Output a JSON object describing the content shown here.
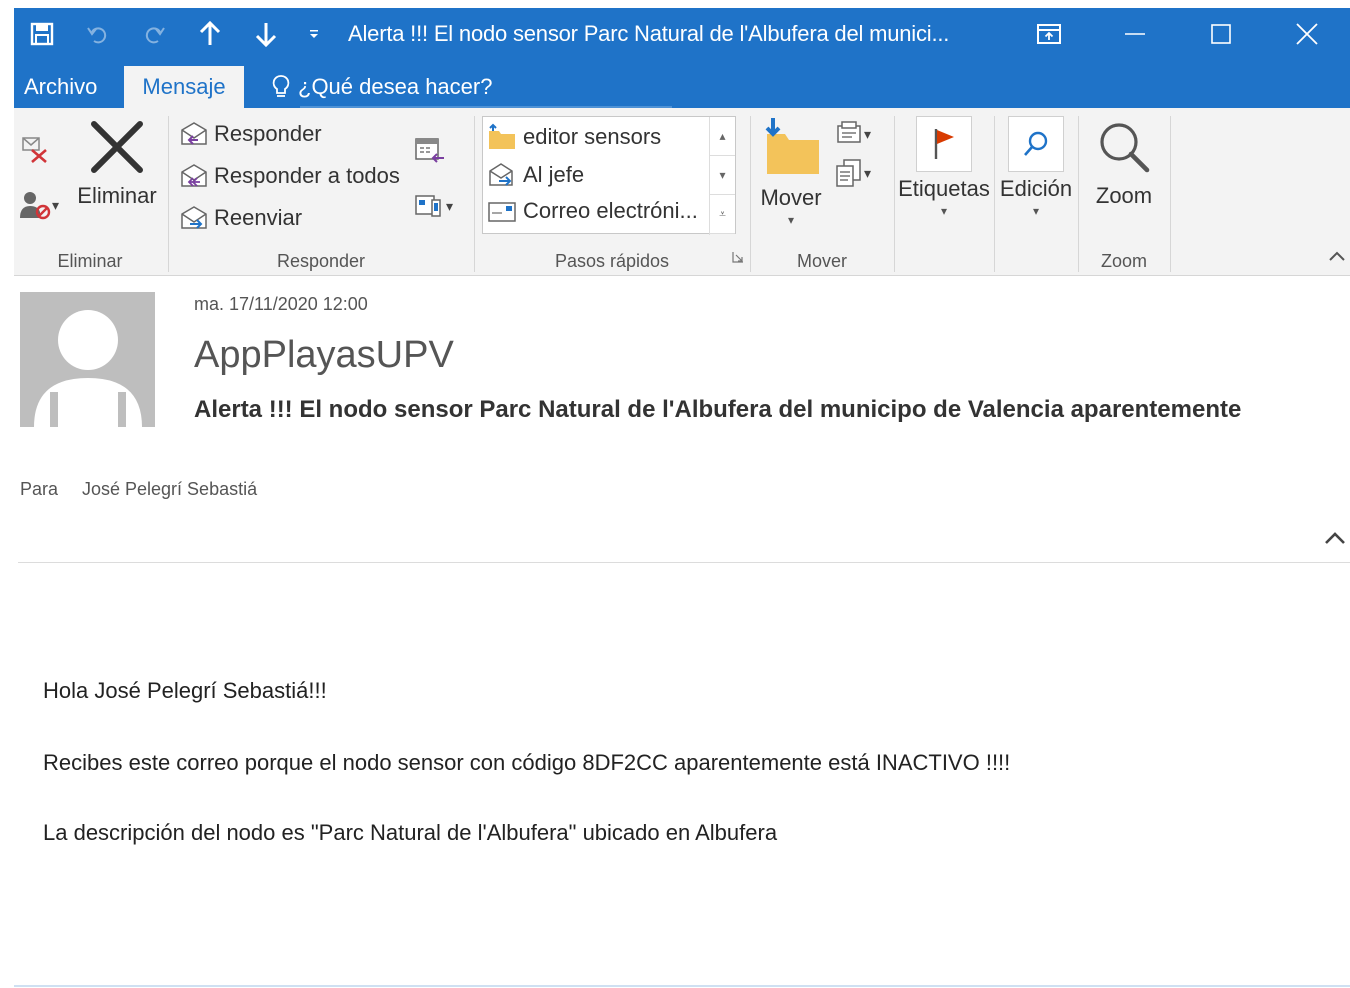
{
  "window": {
    "title": "Alerta !!! El nodo sensor Parc Natural de l'Albufera del munici..."
  },
  "tabs": {
    "archivo": "Archivo",
    "mensaje": "Mensaje",
    "tell_me": "¿Qué desea hacer?"
  },
  "ribbon": {
    "eliminar_group": {
      "label": "Eliminar",
      "delete_button": "Eliminar"
    },
    "responder_group": {
      "label": "Responder",
      "reply": "Responder",
      "reply_all": "Responder a todos",
      "forward": "Reenviar"
    },
    "quick_steps_group": {
      "label": "Pasos rápidos",
      "items": [
        "editor sensors",
        "Al jefe",
        "Correo electróni..."
      ]
    },
    "mover_group": {
      "label": "Mover",
      "move_button": "Mover"
    },
    "etiquetas_button": "Etiquetas",
    "edicion_button": "Edición",
    "zoom_group": {
      "label": "Zoom",
      "zoom_button": "Zoom"
    }
  },
  "message": {
    "date": "ma. 17/11/2020 12:00",
    "sender": "AppPlayasUPV",
    "subject": "Alerta !!! El nodo sensor Parc Natural de l'Albufera del municipo de Valencia aparentemente",
    "to_label": "Para",
    "to_value": "José Pelegrí Sebastiá",
    "body": [
      "Hola José Pelegrí Sebastiá!!!",
      "Recibes este correo porque el nodo sensor con código 8DF2CC aparentemente está INACTIVO !!!!",
      "La descripción del nodo es \"Parc Natural de l'Albufera\" ubicado en Albufera"
    ]
  },
  "colors": {
    "accent": "#1f73c8",
    "ribbon_bg": "#f3f3f3",
    "avatar_bg": "#bebebe",
    "flag_red": "#d83b01",
    "folder_yellow": "#f3c35a"
  }
}
